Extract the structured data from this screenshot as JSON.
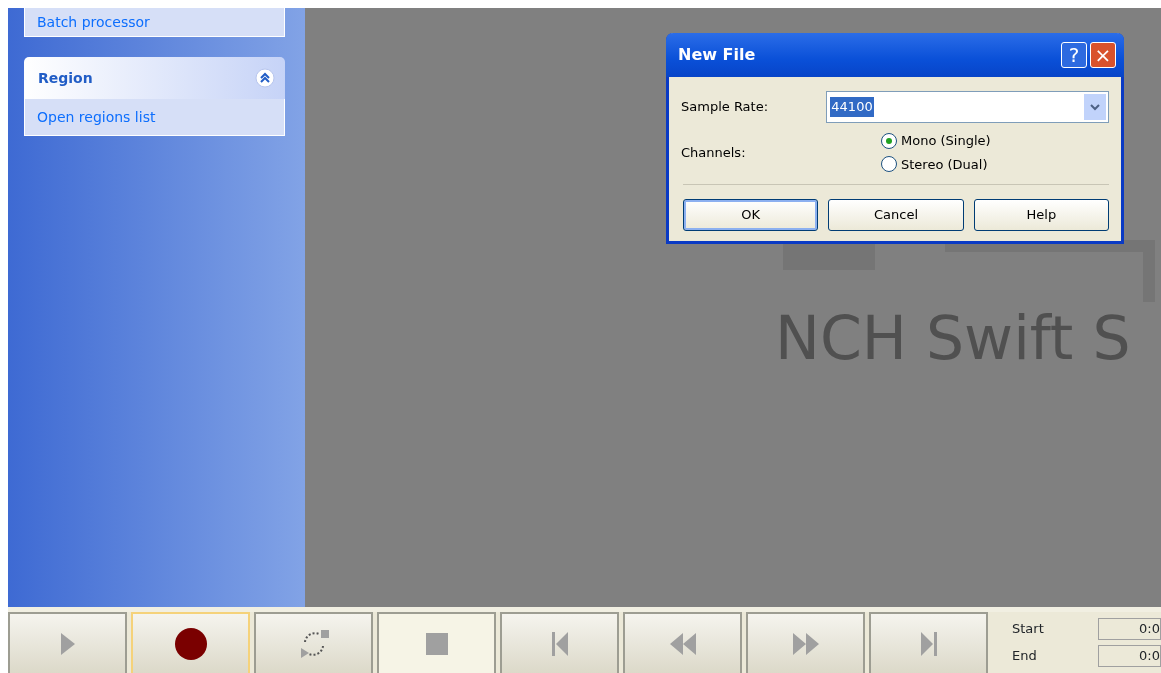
{
  "sidebar": {
    "items": [
      {
        "label": "Batch processor"
      }
    ],
    "groups": [
      {
        "title": "Region",
        "expanded": true,
        "items": [
          {
            "label": "Open regions list"
          }
        ]
      }
    ]
  },
  "workspace": {
    "logo_text": "NCH Swift S"
  },
  "dialog": {
    "title": "New File",
    "help_button": "?",
    "close_button": "×",
    "sample_rate": {
      "label": "Sample Rate:",
      "value": "44100"
    },
    "channels": {
      "label": "Channels:",
      "options": [
        {
          "label": "Mono (Single)",
          "selected": true
        },
        {
          "label": "Stereo (Dual)",
          "selected": false
        }
      ]
    },
    "buttons": [
      {
        "label": "OK",
        "focused": true
      },
      {
        "label": "Cancel",
        "focused": false
      },
      {
        "label": "Help",
        "focused": false
      }
    ]
  },
  "transport": [
    {
      "kind": "play",
      "focused": false,
      "pressed": false
    },
    {
      "kind": "record",
      "focused": true,
      "pressed": false
    },
    {
      "kind": "loop",
      "focused": false,
      "pressed": false
    },
    {
      "kind": "stop",
      "focused": false,
      "pressed": true
    },
    {
      "kind": "start",
      "focused": false,
      "pressed": false
    },
    {
      "kind": "rewind",
      "focused": false,
      "pressed": false
    },
    {
      "kind": "forward",
      "focused": false,
      "pressed": false
    },
    {
      "kind": "end",
      "focused": false,
      "pressed": false
    }
  ],
  "selection": [
    {
      "label": "Start",
      "value": "0:0"
    },
    {
      "label": "End",
      "value": "0:0"
    }
  ]
}
